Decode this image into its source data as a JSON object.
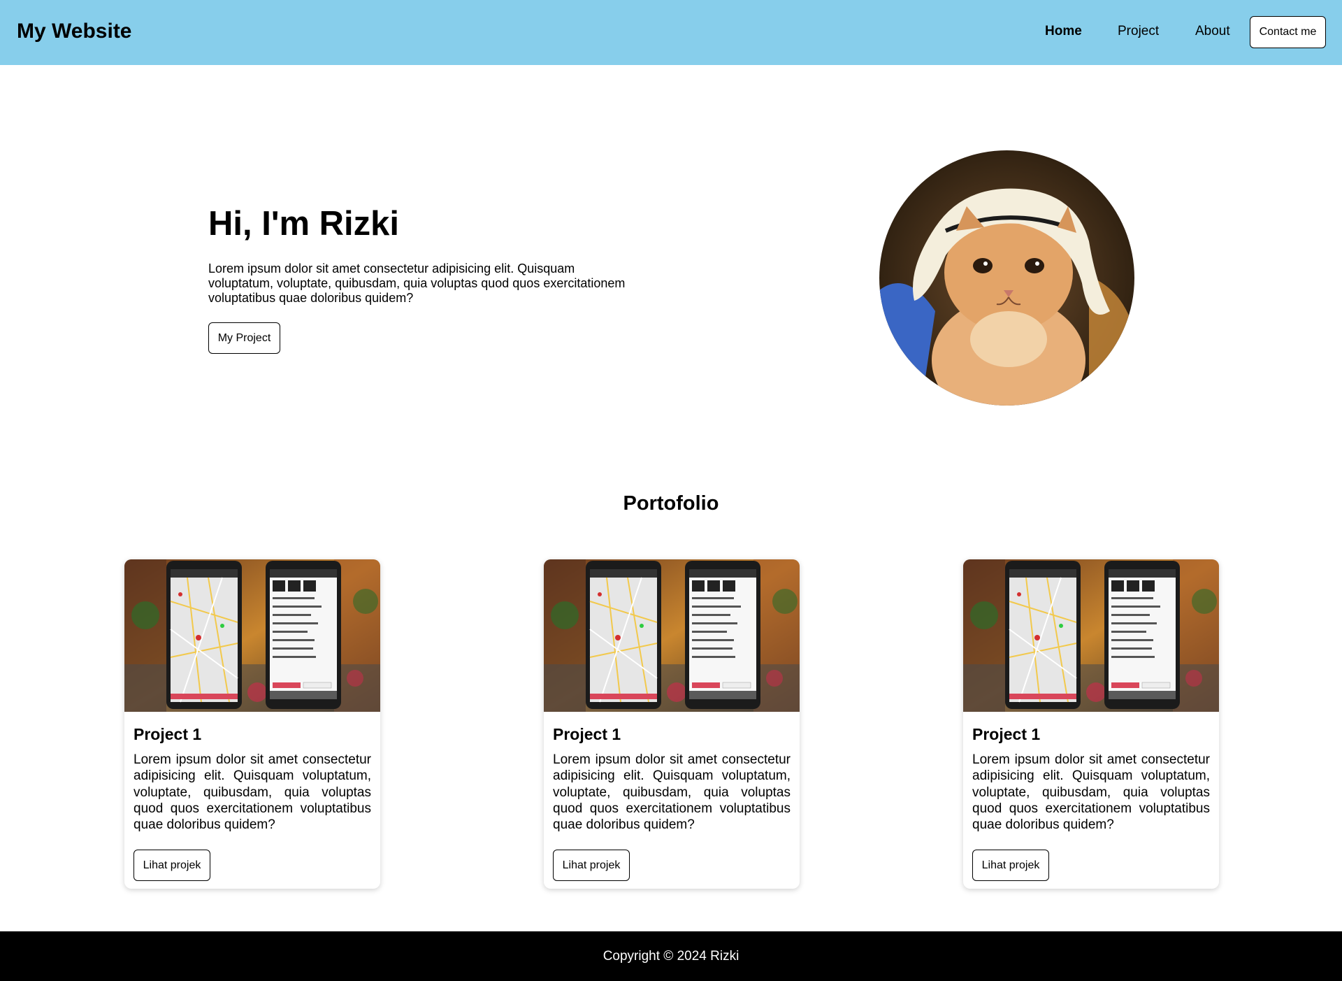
{
  "header": {
    "brand": "My Website",
    "nav": {
      "home": "Home",
      "project": "Project",
      "about": "About",
      "contact": "Contact me"
    }
  },
  "hero": {
    "title": "Hi, I'm Rizki",
    "description": "Lorem ipsum dolor sit amet consectetur adipisicing elit. Quisquam voluptatum, voluptate, quibusdam, quia voluptas quod quos exercitationem voluptatibus quae doloribus quidem?",
    "button": "My Project"
  },
  "portfolio": {
    "title": "Portofolio",
    "cards": [
      {
        "title": "Project 1",
        "text": "Lorem ipsum dolor sit amet consectetur adipisicing elit. Quisquam voluptatum, voluptate, quibusdam, quia voluptas quod quos exercitationem voluptatibus quae doloribus quidem?",
        "button": "Lihat projek"
      },
      {
        "title": "Project 1",
        "text": "Lorem ipsum dolor sit amet consectetur adipisicing elit. Quisquam voluptatum, voluptate, quibusdam, quia voluptas quod quos exercitationem voluptatibus quae doloribus quidem?",
        "button": "Lihat projek"
      },
      {
        "title": "Project 1",
        "text": "Lorem ipsum dolor sit amet consectetur adipisicing elit. Quisquam voluptatum, voluptate, quibusdam, quia voluptas quod quos exercitationem voluptatibus quae doloribus quidem?",
        "button": "Lihat projek"
      }
    ]
  },
  "footer": {
    "copyright": "Copyright © 2024 Rizki"
  },
  "colors": {
    "header_bg": "#87ceeb",
    "footer_bg": "#000000"
  }
}
